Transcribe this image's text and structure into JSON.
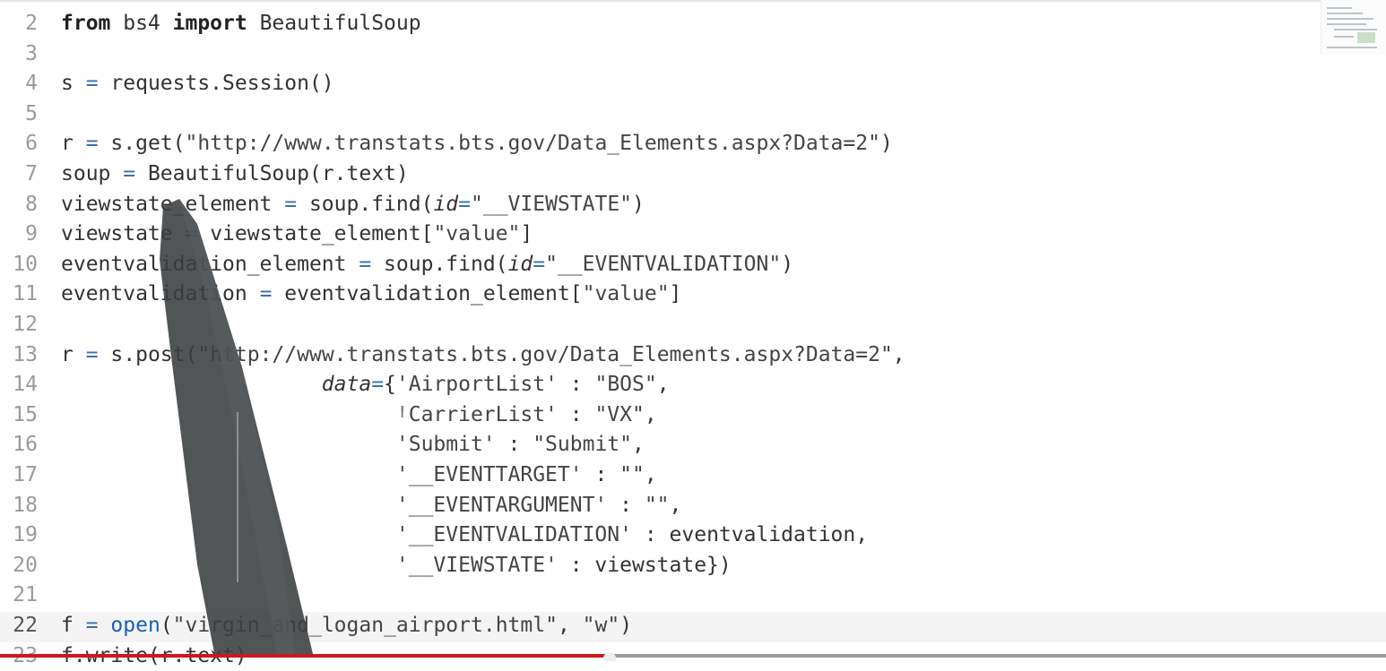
{
  "editor": {
    "current_line": "22",
    "line_numbers": [
      "2",
      "3",
      "4",
      "5",
      "6",
      "7",
      "8",
      "9",
      "10",
      "11",
      "12",
      "13",
      "14",
      "15",
      "16",
      "17",
      "18",
      "19",
      "20",
      "21",
      "22",
      "23"
    ],
    "lines": {
      "l2": {
        "kw1": "from",
        "t1": " bs4 ",
        "kw2": "import",
        "t2": " BeautifulSoup"
      },
      "l4": {
        "t1": "s ",
        "op": "=",
        "t2": " requests.Session()"
      },
      "l6": {
        "t1": "r ",
        "op": "=",
        "t2": " s.get(",
        "s1": "\"http://www.transtats.bts.gov/Data_Elements.aspx?Data=2\"",
        "t3": ")"
      },
      "l7": {
        "t1": "soup ",
        "op": "=",
        "t2": " BeautifulSoup(r.text)"
      },
      "l8": {
        "t1": "viewstate_element ",
        "op": "=",
        "t2": " soup.find(",
        "a1": "id",
        "op2": "=",
        "s1": "\"__VIEWSTATE\"",
        "t3": ")"
      },
      "l9": {
        "t1": "viewstate ",
        "op": "=",
        "t2": " viewstate_element[",
        "s1": "\"value\"",
        "t3": "]"
      },
      "l10": {
        "t1": "eventvalidation_element ",
        "op": "=",
        "t2": " soup.find(",
        "a1": "id",
        "op2": "=",
        "s1": "\"__EVENTVALIDATION\"",
        "t3": ")"
      },
      "l11": {
        "t1": "eventvalidation ",
        "op": "=",
        "t2": " eventvalidation_element[",
        "s1": "\"value\"",
        "t3": "]"
      },
      "l13": {
        "t1": "r ",
        "op": "=",
        "t2": " s.post(",
        "s1": "\"http://www.transtats.bts.gov/Data_Elements.aspx?Data=2\"",
        "t3": ","
      },
      "l14": {
        "indent": "                     ",
        "a1": "data",
        "op2": "=",
        "t1": "{",
        "s1": "'AirportList'",
        "t2": " : ",
        "s2": "\"BOS\"",
        "t3": ","
      },
      "l15": {
        "indent": "                           ",
        "s1": "'CarrierList'",
        "t2": " : ",
        "s2": "\"VX\"",
        "t3": ","
      },
      "l16": {
        "indent": "                           ",
        "s1": "'Submit'",
        "t2": " : ",
        "s2": "\"Submit\"",
        "t3": ","
      },
      "l17": {
        "indent": "                           ",
        "s1": "'__EVENTTARGET'",
        "t2": " : ",
        "s2": "\"\"",
        "t3": ","
      },
      "l18": {
        "indent": "                           ",
        "s1": "'__EVENTARGUMENT'",
        "t2": " : ",
        "s2": "\"\"",
        "t3": ","
      },
      "l19": {
        "indent": "                           ",
        "s1": "'__EVENTVALIDATION'",
        "t2": " : eventvalidation,"
      },
      "l20": {
        "indent": "                           ",
        "s1": "'__VIEWSTATE'",
        "t2": " : viewstate})"
      },
      "l22": {
        "t1": "f ",
        "op": "=",
        "t2": " ",
        "fn": "open",
        "t3": "(",
        "s1": "\"virgin_and_logan_airport.html\"",
        "t4": ", ",
        "s2": "\"w\"",
        "t5": ")"
      },
      "l23": {
        "t1": "f.write(r.text)"
      }
    }
  },
  "video": {
    "progress": 0.44
  },
  "colors": {
    "operator": "#3a6fb0",
    "function": "#1a5fb4",
    "progress_red": "#cc181e"
  }
}
